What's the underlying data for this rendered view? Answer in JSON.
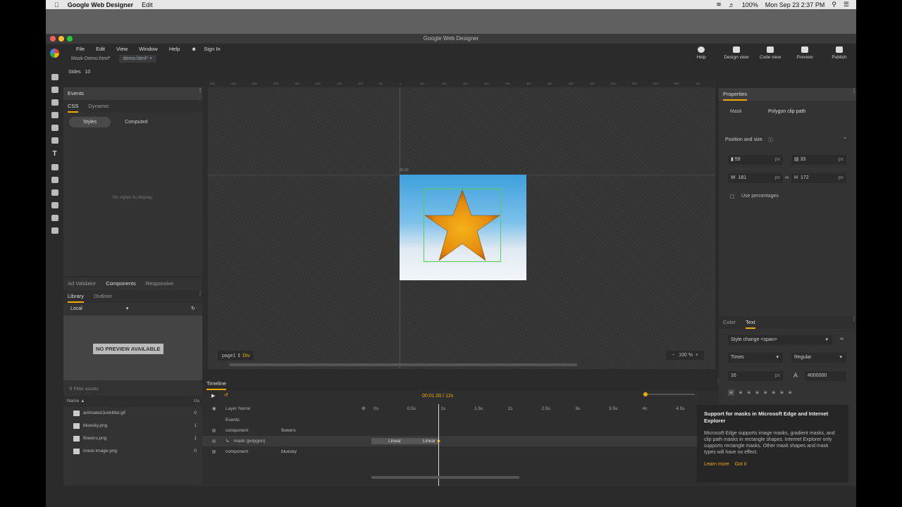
{
  "mac_menubar": {
    "app": "Google Web Designer",
    "menu": "Edit",
    "battery": "100%",
    "datetime": "Mon Sep 23  2:37 PM"
  },
  "window": {
    "title": "Google Web Designer"
  },
  "menu": [
    "File",
    "Edit",
    "View",
    "Window",
    "Help"
  ],
  "sign_in": "Sign In",
  "tabs": [
    {
      "label": "Mask-Demo.html*"
    },
    {
      "label": "demo.html* ×"
    }
  ],
  "toolbar": {
    "help": "Help",
    "design_view": "Design view",
    "code_view": "Code view",
    "preview": "Preview",
    "publish": "Publish"
  },
  "sides": {
    "label": "Sides",
    "value": "10"
  },
  "events_panel": {
    "title": "Events",
    "tabs": [
      "CSS",
      "Dynamic"
    ],
    "subtabs": [
      "Styles",
      "Computed"
    ],
    "empty": "No styles to display."
  },
  "library_panel": {
    "tabs_top": [
      "Ad Validator",
      "Components",
      "Responsive"
    ],
    "tabs": [
      "Library",
      "Outliner"
    ],
    "source": "Local",
    "preview": "NO PREVIEW AVAILABLE",
    "search_placeholder": "Filter assets",
    "col_name": "Name",
    "col_use": "Us",
    "assets": [
      {
        "name": "animatedJunkMat.gif",
        "count": "0"
      },
      {
        "name": "bluesky.png",
        "count": "1"
      },
      {
        "name": "flowers.png",
        "count": "1"
      },
      {
        "name": "mask-image.png",
        "count": "0"
      }
    ]
  },
  "stage": {
    "page": "page1",
    "div": "Div",
    "zoom": "100",
    "zoom_unit": "%",
    "coord_label": "35,00",
    "ruler_ticks": [
      "-450",
      "-400",
      "-350",
      "-300",
      "-250",
      "-200",
      "-150",
      "-100",
      "-50",
      "0",
      "50",
      "100",
      "150",
      "200",
      "250",
      "300",
      "350",
      "400",
      "450",
      "500",
      "550",
      "600",
      "650",
      "700"
    ]
  },
  "timeline": {
    "title": "Timeline",
    "time": "00:01.00 / 12s",
    "layer_name": "Layer Name",
    "ticks": [
      "0s",
      "0.5s",
      "1s",
      "1.5s",
      "2s",
      "2.5s",
      "3s",
      "3.5s",
      "4s",
      "4.5s"
    ],
    "layers": [
      {
        "name": "Events",
        "id": ""
      },
      {
        "name": "component",
        "id": "flowers"
      },
      {
        "name": "mask (polygon)",
        "id": ""
      },
      {
        "name": "component",
        "id": "bluesky"
      }
    ],
    "easing": [
      "Linear",
      "Linear"
    ]
  },
  "properties": {
    "title": "Properties",
    "mask_label": "Mask",
    "mask_value": "Polygon clip path",
    "pos_size": "Position and size",
    "x": "59",
    "y": "33",
    "w": "181",
    "h": "172",
    "unit": "px",
    "use_pct": "Use percentages",
    "tabs": [
      "Color",
      "Text"
    ],
    "style_change": "Style change <span>",
    "font": "Times",
    "weight": "Regular",
    "size": "16",
    "color": "#000000"
  },
  "tip": {
    "title": "Support for masks in Microsoft Edge and Internet Explorer",
    "body": "Microsoft Edge supports image masks, gradient masks, and clip path masks in rectangle shapes. Internet Explorer only supports rectangle masks. Other mask shapes and mask types will have no effect.",
    "learn": "Learn more",
    "got": "Got it"
  },
  "colors": {
    "accent": "#f2a900",
    "selection": "#55cc55"
  }
}
